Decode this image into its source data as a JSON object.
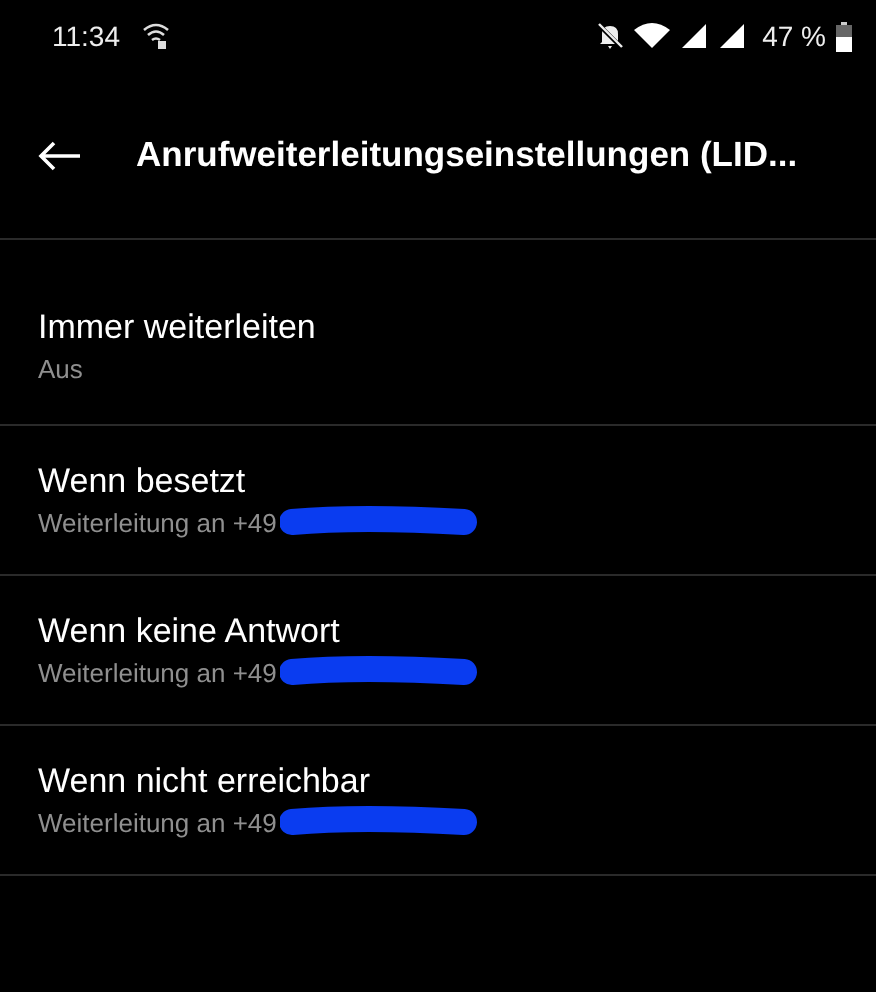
{
  "status_bar": {
    "time": "11:34",
    "battery_text": "47 %"
  },
  "app_bar": {
    "title": "Anrufweiterleitungseinstellungen (LID..."
  },
  "settings": [
    {
      "title": "Immer weiterleiten",
      "summary": "Aus",
      "redacted": false
    },
    {
      "title": "Wenn besetzt",
      "summary": "Weiterleitung an +49",
      "redacted": true
    },
    {
      "title": "Wenn keine Antwort",
      "summary": "Weiterleitung an +49",
      "redacted": true
    },
    {
      "title": "Wenn nicht erreichbar",
      "summary": "Weiterleitung an +49",
      "redacted": true
    }
  ]
}
